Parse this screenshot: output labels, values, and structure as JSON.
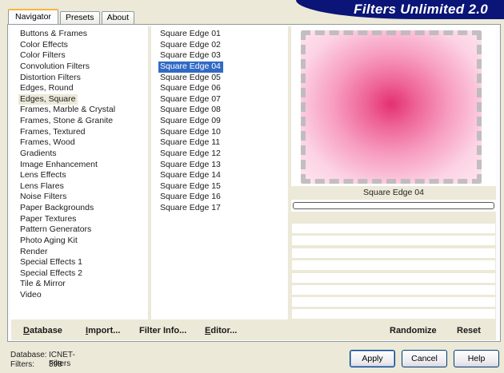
{
  "tabs": [
    {
      "label": "Navigator"
    },
    {
      "label": "Presets"
    },
    {
      "label": "About"
    }
  ],
  "header": {
    "title": "Filters Unlimited 2.0"
  },
  "categories": [
    "Buttons & Frames",
    "Color Effects",
    "Color Filters",
    "Convolution Filters",
    "Distortion Filters",
    "Edges, Round",
    "Edges, Square",
    "Frames, Marble & Crystal",
    "Frames, Stone & Granite",
    "Frames, Textured",
    "Frames, Wood",
    "Gradients",
    "Image Enhancement",
    "Lens Effects",
    "Lens Flares",
    "Noise Filters",
    "Paper Backgrounds",
    "Paper Textures",
    "Pattern Generators",
    "Photo Aging Kit",
    "Render",
    "Special Effects 1",
    "Special Effects 2",
    "Tile & Mirror",
    "Video"
  ],
  "selected_category": "Edges, Square",
  "filters": [
    "Square Edge 01",
    "Square Edge 02",
    "Square Edge 03",
    "Square Edge 04",
    "Square Edge 05",
    "Square Edge 06",
    "Square Edge 07",
    "Square Edge 08",
    "Square Edge 09",
    "Square Edge 10",
    "Square Edge 11",
    "Square Edge 12",
    "Square Edge 13",
    "Square Edge 14",
    "Square Edge 15",
    "Square Edge 16",
    "Square Edge 17"
  ],
  "selected_filter": "Square Edge 04",
  "preview": {
    "filter_name": "Square Edge 04"
  },
  "toolbar": {
    "database": {
      "underlined": "D",
      "rest": "atabase"
    },
    "import": {
      "underlined": "I",
      "rest": "mport..."
    },
    "filter_info": "Filter Info...",
    "editor": {
      "underlined": "E",
      "rest": "ditor..."
    },
    "randomize": "Randomize",
    "reset": "Reset"
  },
  "status": {
    "database_label": "Database:",
    "database_value": "ICNET-Filters",
    "filters_label": "Filters:",
    "filters_value": "398"
  },
  "buttons": {
    "apply": "Apply",
    "cancel": "Cancel",
    "help": "Help"
  },
  "colors": {
    "accent": "#316ac5",
    "banner": "#0a1577",
    "preview_center": "#e4306f"
  }
}
